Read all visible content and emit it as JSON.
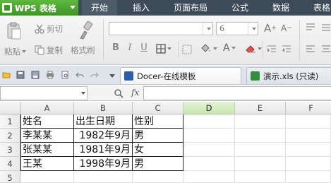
{
  "app": {
    "title": "WPS 表格",
    "menu": [
      "开始",
      "插入",
      "页面布局",
      "公式",
      "数据",
      "表格"
    ]
  },
  "ribbon": {
    "paste_label": "粘贴",
    "cut_label": "剪切",
    "copy_label": "复制",
    "format_painter_label": "格式刷",
    "font_size_value": "6",
    "bold_label": "B",
    "italic_label": "I",
    "underline_label": "U"
  },
  "doc_tabs": [
    {
      "label": "Docer-在线模板",
      "active": true
    },
    {
      "label": "演示.xls (只读)",
      "active": false
    }
  ],
  "formula_bar": {
    "fx_label": "fx",
    "cell_ref": "",
    "value": ""
  },
  "sheet": {
    "columns": [
      "A",
      "B",
      "C",
      "D",
      "E",
      "F"
    ],
    "selected_column": "D",
    "rows": [
      "1",
      "2",
      "3",
      "4",
      "5"
    ],
    "cells": [
      [
        "姓名",
        "出生日期",
        "性别"
      ],
      [
        "李某某",
        "1982年9月",
        "男"
      ],
      [
        "张某某",
        "1981年9月",
        "女"
      ],
      [
        "王某",
        "1998年9月",
        "男"
      ]
    ]
  },
  "colors": {
    "accent_green": "#3f9427",
    "titlebar": "#3d4a57",
    "selected_column_header": "#c9e6ad"
  }
}
